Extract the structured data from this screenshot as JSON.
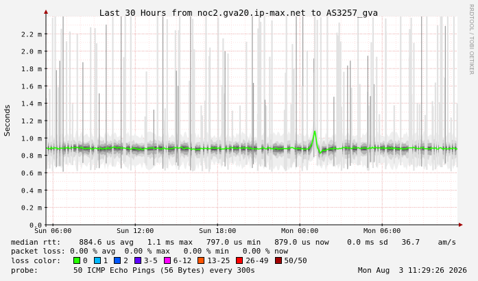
{
  "chart_data": {
    "type": "area",
    "title": "Last 30 Hours from noc2.gva20.ip-max.net to AS3257_gva",
    "ylabel": "Seconds",
    "watermark": "RRDTOOL / TOBI OETIKER",
    "y_unit_suffix": "m",
    "ylim": [
      0,
      0.0024
    ],
    "yticks": [
      {
        "value": 0.0,
        "label": "0.0"
      },
      {
        "value": 0.0002,
        "label": "0.2 m"
      },
      {
        "value": 0.0004,
        "label": "0.4 m"
      },
      {
        "value": 0.0006,
        "label": "0.6 m"
      },
      {
        "value": 0.0008,
        "label": "0.8 m"
      },
      {
        "value": 0.001,
        "label": "1.0 m"
      },
      {
        "value": 0.0012,
        "label": "1.2 m"
      },
      {
        "value": 0.0014,
        "label": "1.4 m"
      },
      {
        "value": 0.0016,
        "label": "1.6 m"
      },
      {
        "value": 0.0018,
        "label": "1.8 m"
      },
      {
        "value": 0.002,
        "label": "2.0 m"
      },
      {
        "value": 0.0022,
        "label": "2.2 m"
      }
    ],
    "xlim_hours": [
      -30,
      0
    ],
    "xticks": [
      {
        "hour": -29.49,
        "label": "Sun 06:00"
      },
      {
        "hour": -23.49,
        "label": "Sun 12:00"
      },
      {
        "hour": -17.49,
        "label": "Sun 18:00"
      },
      {
        "hour": -11.49,
        "label": "Mon 00:00"
      },
      {
        "hour": -5.49,
        "label": "Mon 06:00"
      }
    ],
    "grid": true,
    "series": [
      {
        "name": "median rtt",
        "x_hours": [
          -30,
          -29,
          -28,
          -27,
          -26,
          -25,
          -24,
          -23,
          -22,
          -21,
          -20,
          -19,
          -18,
          -17,
          -16,
          -15,
          -14,
          -13,
          -12,
          -11,
          -10.8,
          -10.6,
          -10.4,
          -10.2,
          -10,
          -9.8,
          -9,
          -8,
          -7,
          -6,
          -5,
          -4,
          -3,
          -2,
          -1,
          0
        ],
        "values": [
          0.000885,
          0.000878,
          0.00089,
          0.000882,
          0.000875,
          0.000888,
          0.00088,
          0.000872,
          0.000885,
          0.000878,
          0.000885,
          0.00087,
          0.000882,
          0.000878,
          0.000885,
          0.00088,
          0.000882,
          0.000875,
          0.000882,
          0.00087,
          0.00088,
          0.00093,
          0.00109,
          0.00088,
          0.00083,
          0.00086,
          0.00088,
          0.000885,
          0.00088,
          0.000888,
          0.000882,
          0.000876,
          0.000885,
          0.00088,
          0.000882,
          0.000879
        ]
      }
    ]
  },
  "legend": {
    "median_rtt": {
      "label": "median rtt:",
      "avg": "884.6 us avg",
      "max": "1.1 ms max",
      "min": "797.0 us min",
      "now": "879.0 us now",
      "sd": "0.0 ms sd",
      "ams": "36.7",
      "ams_unit": "am/s"
    },
    "packet_loss": {
      "label": "packet loss:",
      "avg": "0.00 % avg",
      "max": "0.00 % max",
      "min": "0.00 % min",
      "now": "0.00 % now"
    },
    "loss_color": {
      "label": "loss color:",
      "items": [
        {
          "label": "0",
          "color": "#26ff00"
        },
        {
          "label": "1",
          "color": "#00b8ff"
        },
        {
          "label": "2",
          "color": "#0059ff"
        },
        {
          "label": "3-5",
          "color": "#5e00ff"
        },
        {
          "label": "6-12",
          "color": "#ff00ff"
        },
        {
          "label": "13-25",
          "color": "#ff5500"
        },
        {
          "label": "26-49",
          "color": "#ff0000"
        },
        {
          "label": "50/50",
          "color": "#a10000"
        }
      ]
    },
    "probe": {
      "label": "probe:",
      "text": "50 ICMP Echo Pings (56 Bytes) every 300s",
      "timestamp": "Mon Aug  3 11:29:26 2026"
    }
  }
}
